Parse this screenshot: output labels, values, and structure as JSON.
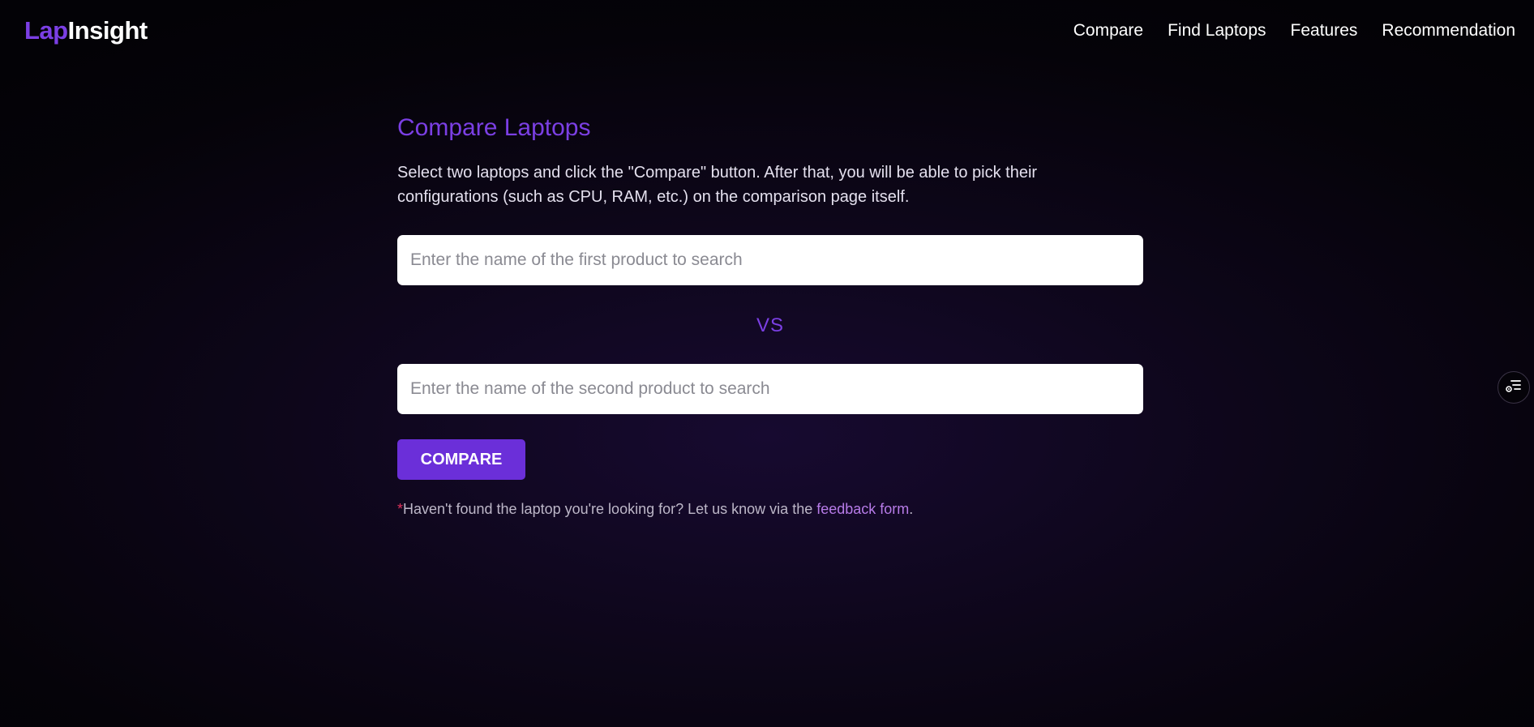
{
  "header": {
    "logo_part1": "Lap",
    "logo_part2": "Insight",
    "nav": [
      {
        "label": "Compare"
      },
      {
        "label": "Find Laptops"
      },
      {
        "label": "Features"
      },
      {
        "label": "Recommendation"
      }
    ]
  },
  "main": {
    "title": "Compare Laptops",
    "description": "Select two laptops and click the \"Compare\" button. After that, you will be able to pick their configurations (such as CPU, RAM, etc.) on the comparison page itself.",
    "first_search": {
      "value": "",
      "placeholder": "Enter the name of the first product to search"
    },
    "vs_label": "VS",
    "second_search": {
      "value": "",
      "placeholder": "Enter the name of the second product to search"
    },
    "compare_button": "COMPARE",
    "footnote": {
      "star": "*",
      "text": "Haven't found the laptop you're looking for? Let us know via the ",
      "link": "feedback form",
      "end": "."
    }
  },
  "floating_button": {
    "icon": "list-settings-icon"
  },
  "colors": {
    "accent": "#7b3fe4",
    "button": "#6b2fd9",
    "link": "#b77be8",
    "asterisk": "#e0335c",
    "background": "#05030a"
  }
}
